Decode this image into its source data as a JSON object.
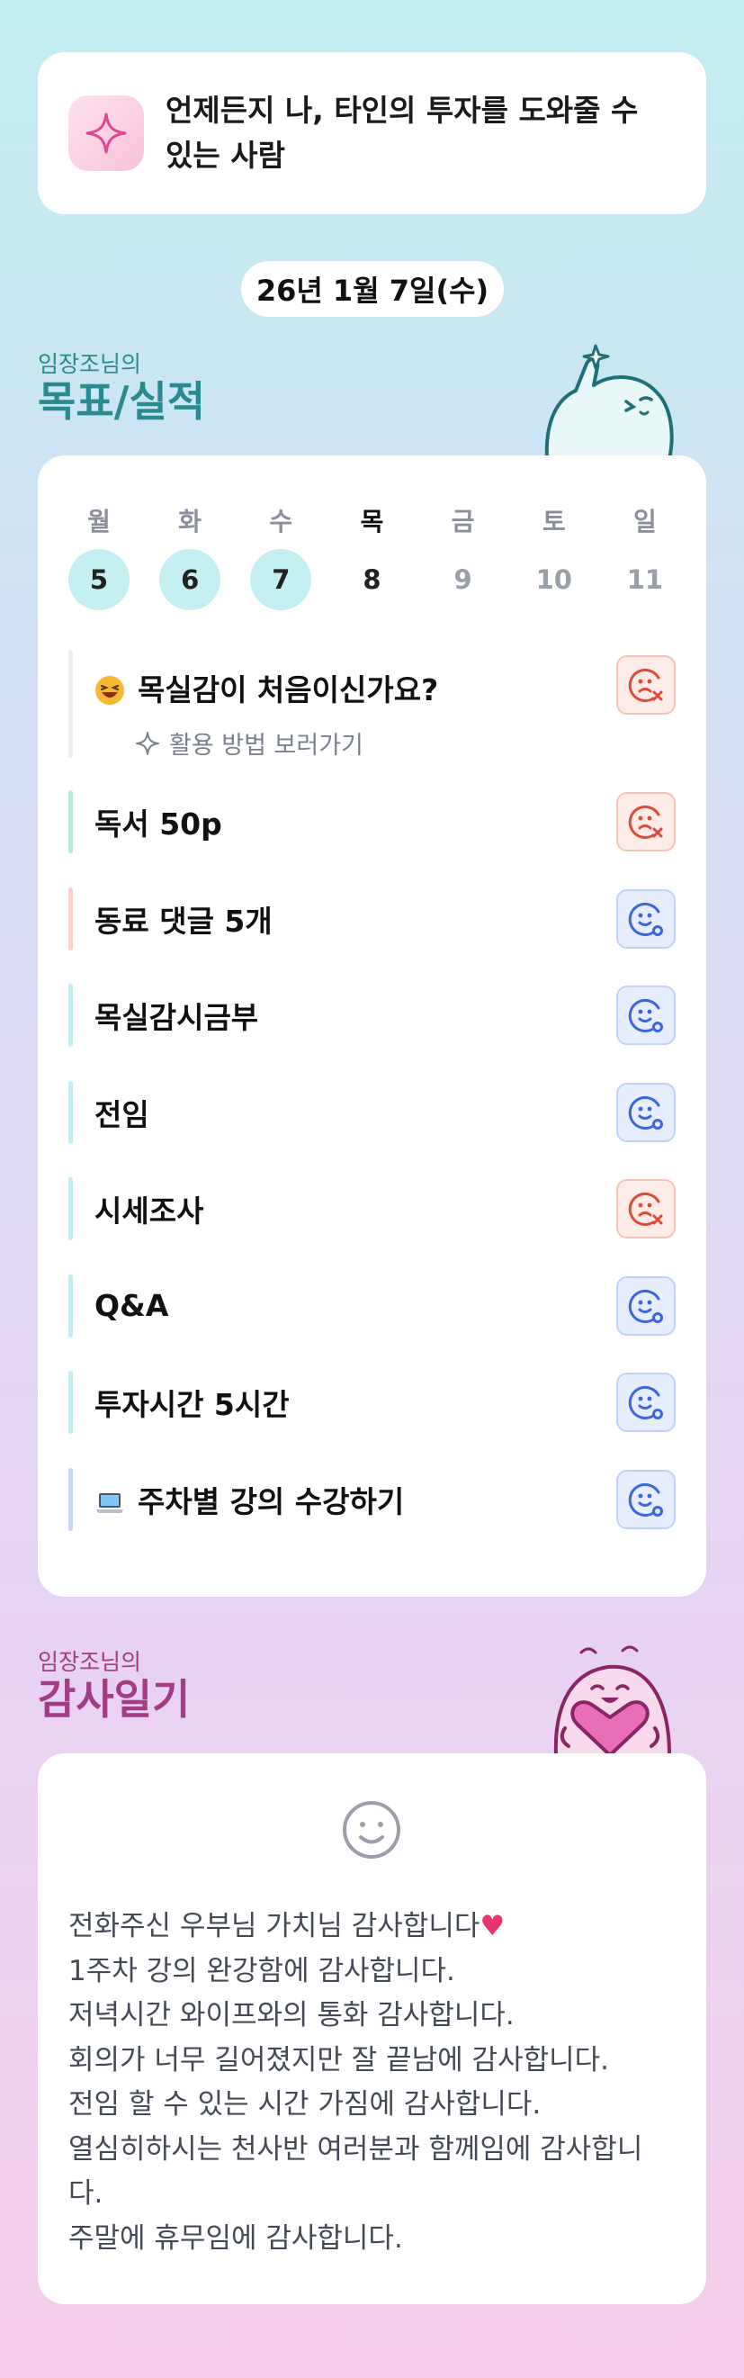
{
  "motto": {
    "text": "언제든지 나, 타인의 투자를 도와줄 수 있는 사람",
    "icon": "sparkle-icon"
  },
  "date": "26년 1월 7일(수)",
  "goals_section": {
    "sub": "임장조님의",
    "title": "목표/실적"
  },
  "week": [
    {
      "name": "월",
      "num": "5",
      "state": "done"
    },
    {
      "name": "화",
      "num": "6",
      "state": "done"
    },
    {
      "name": "수",
      "num": "7",
      "state": "done"
    },
    {
      "name": "목",
      "num": "8",
      "state": "today"
    },
    {
      "name": "금",
      "num": "9",
      "state": "future"
    },
    {
      "name": "토",
      "num": "10",
      "state": "future"
    },
    {
      "name": "일",
      "num": "11",
      "state": "future"
    }
  ],
  "first_goal": {
    "label": "목실감이 처음이신가요?",
    "guide": "활용 방법 보러가기",
    "status": "fail"
  },
  "goals": [
    {
      "label": "독서 50p",
      "status": "fail",
      "bar": "#b7ebd8"
    },
    {
      "label": "동료 댓글 5개",
      "status": "ok",
      "bar": "#fbd3cc"
    },
    {
      "label": "목실감시금부",
      "status": "ok",
      "bar": "#c2eef1"
    },
    {
      "label": "전임",
      "status": "ok",
      "bar": "#c2eef1"
    },
    {
      "label": "시세조사",
      "status": "fail",
      "bar": "#c2eef1"
    },
    {
      "label": "Q&A",
      "status": "ok",
      "bar": "#c2eef1"
    },
    {
      "label": "투자시간 5시간",
      "status": "ok",
      "bar": "#c2eef1"
    },
    {
      "label": "주차별 강의 수강하기",
      "status": "ok",
      "bar": "#c9d8f5"
    }
  ],
  "diary_section": {
    "sub": "임장조님의",
    "title": "감사일기"
  },
  "diary": {
    "line1": "전화주신 우부님 가치님 감사합니다",
    "heart": "♥",
    "rest": "1주차 강의 완강함에 감사합니다.\n저녁시간 와이프와의 통화 감사합니다.\n회의가 너무 길어졌지만 잘 끝남에 감사합니다.\n전임 할 수 있는 시간 가짐에 감사합니다.\n열심히하시는 천사반 여러분과 함께임에 감사합니\n다.\n주말에 휴무임에 감사합니다."
  }
}
